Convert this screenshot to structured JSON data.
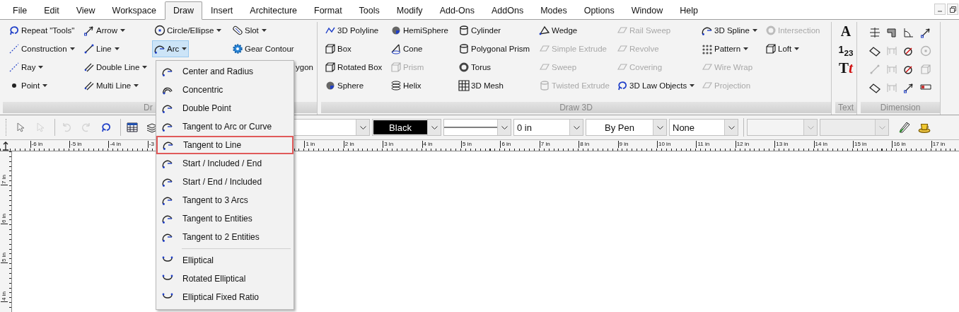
{
  "menu_bar": {
    "items": [
      {
        "label": "File",
        "selected": false
      },
      {
        "label": "Edit",
        "selected": false
      },
      {
        "label": "View",
        "selected": false
      },
      {
        "label": "Workspace",
        "selected": false
      },
      {
        "label": "Draw",
        "selected": true
      },
      {
        "label": "Insert",
        "selected": false
      },
      {
        "label": "Architecture",
        "selected": false
      },
      {
        "label": "Format",
        "selected": false
      },
      {
        "label": "Tools",
        "selected": false
      },
      {
        "label": "Modify",
        "selected": false
      },
      {
        "label": "Add-Ons",
        "selected": false
      },
      {
        "label": "AddOns",
        "selected": false
      },
      {
        "label": "Modes",
        "selected": false
      },
      {
        "label": "Options",
        "selected": false
      },
      {
        "label": "Window",
        "selected": false
      },
      {
        "label": "Help",
        "selected": false
      }
    ]
  },
  "ribbon": {
    "groups": [
      {
        "kind": "tools",
        "label": "Dr",
        "columns": [
          [
            {
              "label": "Repeat \"Tools\"",
              "dropdown": false,
              "disabled": false,
              "pressed": false
            },
            {
              "label": "Construction",
              "dropdown": true,
              "disabled": false,
              "pressed": false
            },
            {
              "label": "Ray",
              "dropdown": true,
              "disabled": false,
              "pressed": false
            },
            {
              "label": "Point",
              "dropdown": true,
              "disabled": false,
              "pressed": false
            }
          ],
          [
            {
              "label": "Arrow",
              "dropdown": true,
              "disabled": false,
              "pressed": false
            },
            {
              "label": "Line",
              "dropdown": true,
              "disabled": false,
              "pressed": false
            },
            {
              "label": "Double Line",
              "dropdown": true,
              "disabled": false,
              "pressed": false
            },
            {
              "label": "Multi Line",
              "dropdown": true,
              "disabled": false,
              "pressed": false
            }
          ],
          [
            {
              "label": "Circle/Ellipse",
              "dropdown": true,
              "disabled": false,
              "pressed": false
            },
            {
              "label": "Arc",
              "dropdown": true,
              "disabled": false,
              "pressed": true
            }
          ],
          [
            {
              "label": "Slot",
              "dropdown": true,
              "disabled": false,
              "pressed": false
            },
            {
              "label": "Gear Contour",
              "dropdown": false,
              "disabled": false,
              "pressed": false
            },
            {
              "label": "ygon",
              "dropdown": false,
              "disabled": false,
              "pressed": false,
              "cut": true
            }
          ]
        ]
      },
      {
        "kind": "tools",
        "label": "Draw 3D",
        "columns": [
          [
            {
              "label": "3D Polyline",
              "dropdown": false,
              "disabled": false,
              "pressed": false
            },
            {
              "label": "Box",
              "dropdown": false,
              "disabled": false,
              "pressed": false
            },
            {
              "label": "Rotated Box",
              "dropdown": false,
              "disabled": false,
              "pressed": false
            },
            {
              "label": "Sphere",
              "dropdown": false,
              "disabled": false,
              "pressed": false
            }
          ],
          [
            {
              "label": "HemiSphere",
              "dropdown": false,
              "disabled": false,
              "pressed": false
            },
            {
              "label": "Cone",
              "dropdown": false,
              "disabled": false,
              "pressed": false
            },
            {
              "label": "Prism",
              "dropdown": false,
              "disabled": true,
              "pressed": false
            },
            {
              "label": "Helix",
              "dropdown": false,
              "disabled": false,
              "pressed": false
            }
          ],
          [
            {
              "label": "Cylinder",
              "dropdown": false,
              "disabled": false,
              "pressed": false
            },
            {
              "label": "Polygonal Prism",
              "dropdown": false,
              "disabled": false,
              "pressed": false
            },
            {
              "label": "Torus",
              "dropdown": false,
              "disabled": false,
              "pressed": false
            },
            {
              "label": "3D Mesh",
              "dropdown": false,
              "disabled": false,
              "pressed": false
            }
          ],
          [
            {
              "label": "Wedge",
              "dropdown": false,
              "disabled": false,
              "pressed": false
            },
            {
              "label": "Simple Extrude",
              "dropdown": false,
              "disabled": true,
              "pressed": false
            },
            {
              "label": "Sweep",
              "dropdown": false,
              "disabled": true,
              "pressed": false
            },
            {
              "label": "Twisted Extrude",
              "dropdown": false,
              "disabled": true,
              "pressed": false
            }
          ],
          [
            {
              "label": "Rail Sweep",
              "dropdown": false,
              "disabled": true,
              "pressed": false
            },
            {
              "label": "Revolve",
              "dropdown": false,
              "disabled": true,
              "pressed": false
            },
            {
              "label": "Covering",
              "dropdown": false,
              "disabled": true,
              "pressed": false
            },
            {
              "label": "3D Law Objects",
              "dropdown": true,
              "disabled": false,
              "pressed": false
            }
          ],
          [
            {
              "label": "3D Spline",
              "dropdown": true,
              "disabled": false,
              "pressed": false
            },
            {
              "label": "Pattern",
              "dropdown": true,
              "disabled": false,
              "pressed": false
            },
            {
              "label": "Wire Wrap",
              "dropdown": false,
              "disabled": true,
              "pressed": false
            },
            {
              "label": "Projection",
              "dropdown": false,
              "disabled": true,
              "pressed": false
            }
          ],
          [
            {
              "label": "Intersection",
              "dropdown": false,
              "disabled": true,
              "pressed": false
            },
            {
              "label": "Loft",
              "dropdown": true,
              "disabled": false,
              "pressed": false
            }
          ]
        ]
      },
      {
        "kind": "glyphs",
        "label": "Text",
        "glyphs": [
          {
            "kind": "plain",
            "text": "A"
          },
          {
            "kind": "plain",
            "text": "1$_{2}$$_{3}$"
          },
          {
            "kind": "accent",
            "text": "T",
            "accent": "t"
          }
        ]
      },
      {
        "kind": "icons",
        "label": "Dimension",
        "icons": [
          {
            "disabled": false
          },
          {
            "disabled": false
          },
          {
            "disabled": false
          },
          {
            "disabled": false
          },
          {
            "disabled": false
          },
          {
            "disabled": true
          },
          {
            "disabled": false
          },
          {
            "disabled": true
          },
          {
            "disabled": true
          },
          {
            "disabled": true
          },
          {
            "disabled": false
          },
          {
            "disabled": true
          },
          {
            "disabled": false
          },
          {
            "disabled": true
          },
          {
            "disabled": false
          },
          {
            "disabled": false
          }
        ]
      }
    ]
  },
  "toolbar": {
    "tools": [
      {
        "disabled": false
      },
      {
        "disabled": true
      },
      {
        "disabled": true
      },
      {
        "disabled": true
      },
      {
        "disabled": false
      },
      {
        "disabled": false
      },
      {
        "disabled": false
      }
    ],
    "combos": [
      {
        "kind": "text",
        "disabled": false
      },
      {
        "kind": "color",
        "value": "Black",
        "disabled": false
      },
      {
        "kind": "linestyle",
        "disabled": false
      },
      {
        "kind": "text",
        "value": "0 in",
        "disabled": false
      },
      {
        "kind": "center",
        "value": "By Pen",
        "disabled": false
      },
      {
        "kind": "text",
        "value": "None",
        "disabled": false
      },
      {
        "kind": "text",
        "disabled": true
      },
      {
        "kind": "text",
        "disabled": true
      }
    ]
  },
  "ruler": {
    "left_labels": [
      "-6 in",
      "-5 in",
      "-4 in",
      "-3"
    ],
    "right_labels": [
      "1 in",
      "2 in",
      "3 in",
      "4 in",
      "5 in",
      "6 in",
      "7 in",
      "8 in",
      "9 in",
      "10 in",
      "11 in",
      "12 in",
      "13 in",
      "14 in",
      "15 in",
      "16 in",
      "17 in"
    ],
    "vertical_labels": [
      "7 in",
      "6 in",
      "5 in",
      "4 in"
    ]
  },
  "arc_menu": {
    "sections": [
      [
        {
          "label": "Center and Radius",
          "selected": false
        },
        {
          "label": "Concentric",
          "selected": false
        },
        {
          "label": "Double Point",
          "selected": false
        },
        {
          "label": "Tangent to Arc or Curve",
          "selected": false
        },
        {
          "label": "Tangent to Line",
          "selected": true
        },
        {
          "label": "Start / Included / End",
          "selected": false
        },
        {
          "label": "Start / End / Included",
          "selected": false
        },
        {
          "label": "Tangent to 3 Arcs",
          "selected": false
        },
        {
          "label": "Tangent to Entities",
          "selected": false
        },
        {
          "label": "Tangent to 2 Entities",
          "selected": false
        }
      ],
      [
        {
          "label": "Elliptical",
          "selected": false
        },
        {
          "label": "Rotated Elliptical",
          "selected": false
        },
        {
          "label": "Elliptical Fixed Ratio",
          "selected": false
        }
      ]
    ]
  }
}
